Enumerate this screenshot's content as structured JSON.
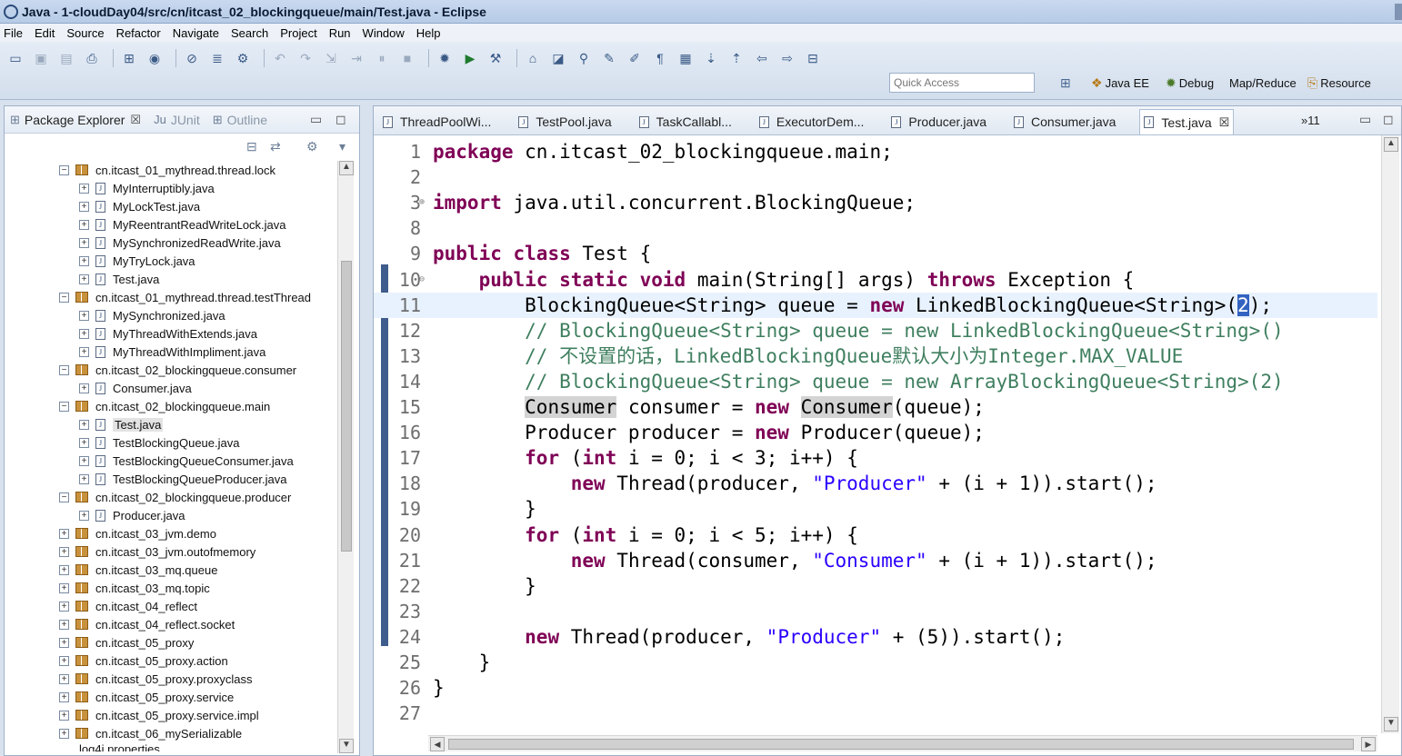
{
  "window": {
    "title": "Java - 1-cloudDay04/src/cn/itcast_02_blockingqueue/main/Test.java - Eclipse"
  },
  "menu": [
    "File",
    "Edit",
    "Source",
    "Refactor",
    "Navigate",
    "Search",
    "Project",
    "Run",
    "Window",
    "Help"
  ],
  "toolbar": {
    "quick_access_placeholder": "Quick Access",
    "perspectives": [
      "Java EE",
      "Debug",
      "Map/Reduce",
      "Resource"
    ]
  },
  "explorer": {
    "tabs": [
      {
        "label": "Package Explorer",
        "active": true
      },
      {
        "label": "JUnit",
        "active": false
      },
      {
        "label": "Outline",
        "active": false
      }
    ],
    "tree": [
      {
        "level": 0,
        "kind": "package",
        "expander": "−",
        "label": "cn.itcast_01_mythread.thread.lock"
      },
      {
        "level": 1,
        "kind": "file",
        "expander": "+",
        "label": "MyInterruptibly.java"
      },
      {
        "level": 1,
        "kind": "file",
        "expander": "+",
        "label": "MyLockTest.java"
      },
      {
        "level": 1,
        "kind": "file",
        "expander": "+",
        "label": "MyReentrantReadWriteLock.java"
      },
      {
        "level": 1,
        "kind": "file",
        "expander": "+",
        "label": "MySynchronizedReadWrite.java"
      },
      {
        "level": 1,
        "kind": "file",
        "expander": "+",
        "label": "MyTryLock.java"
      },
      {
        "level": 1,
        "kind": "file",
        "expander": "+",
        "label": "Test.java"
      },
      {
        "level": 0,
        "kind": "package",
        "expander": "−",
        "label": "cn.itcast_01_mythread.thread.testThread"
      },
      {
        "level": 1,
        "kind": "file",
        "expander": "+",
        "label": "MySynchronized.java"
      },
      {
        "level": 1,
        "kind": "file",
        "expander": "+",
        "label": "MyThreadWithExtends.java"
      },
      {
        "level": 1,
        "kind": "file",
        "expander": "+",
        "label": "MyThreadWithImpliment.java"
      },
      {
        "level": 0,
        "kind": "package",
        "expander": "−",
        "label": "cn.itcast_02_blockingqueue.consumer"
      },
      {
        "level": 1,
        "kind": "file",
        "expander": "+",
        "label": "Consumer.java"
      },
      {
        "level": 0,
        "kind": "package",
        "expander": "−",
        "label": "cn.itcast_02_blockingqueue.main"
      },
      {
        "level": 1,
        "kind": "file",
        "expander": "+",
        "label": "Test.java",
        "selected": true
      },
      {
        "level": 1,
        "kind": "file",
        "expander": "+",
        "label": "TestBlockingQueue.java"
      },
      {
        "level": 1,
        "kind": "file",
        "expander": "+",
        "label": "TestBlockingQueueConsumer.java"
      },
      {
        "level": 1,
        "kind": "file",
        "expander": "+",
        "label": "TestBlockingQueueProducer.java"
      },
      {
        "level": 0,
        "kind": "package",
        "expander": "−",
        "label": "cn.itcast_02_blockingqueue.producer"
      },
      {
        "level": 1,
        "kind": "file",
        "expander": "+",
        "label": "Producer.java"
      },
      {
        "level": 0,
        "kind": "package",
        "expander": "+",
        "label": "cn.itcast_03_jvm.demo"
      },
      {
        "level": 0,
        "kind": "package",
        "expander": "+",
        "label": "cn.itcast_03_jvm.outofmemory"
      },
      {
        "level": 0,
        "kind": "package",
        "expander": "+",
        "label": "cn.itcast_03_mq.queue"
      },
      {
        "level": 0,
        "kind": "package",
        "expander": "+",
        "label": "cn.itcast_03_mq.topic"
      },
      {
        "level": 0,
        "kind": "package",
        "expander": "+",
        "label": "cn.itcast_04_reflect"
      },
      {
        "level": 0,
        "kind": "package",
        "expander": "+",
        "label": "cn.itcast_04_reflect.socket"
      },
      {
        "level": 0,
        "kind": "package",
        "expander": "+",
        "label": "cn.itcast_05_proxy"
      },
      {
        "level": 0,
        "kind": "package",
        "expander": "+",
        "label": "cn.itcast_05_proxy.action"
      },
      {
        "level": 0,
        "kind": "package",
        "expander": "+",
        "label": "cn.itcast_05_proxy.proxyclass"
      },
      {
        "level": 0,
        "kind": "package",
        "expander": "+",
        "label": "cn.itcast_05_proxy.service"
      },
      {
        "level": 0,
        "kind": "package",
        "expander": "+",
        "label": "cn.itcast_05_proxy.service.impl"
      },
      {
        "level": 0,
        "kind": "package",
        "expander": "+",
        "label": "cn.itcast_06_mySerializable"
      }
    ],
    "partial_row": "log4j.properties"
  },
  "editor": {
    "tabs": [
      {
        "label": "ThreadPoolWi...",
        "active": false
      },
      {
        "label": "TestPool.java",
        "active": false
      },
      {
        "label": "TaskCallabl...",
        "active": false
      },
      {
        "label": "ExecutorDem...",
        "active": false
      },
      {
        "label": "Producer.java",
        "active": false
      },
      {
        "label": "Consumer.java",
        "active": false
      },
      {
        "label": "Test.java",
        "active": true
      }
    ],
    "overflow_count": "»11",
    "lines": [
      {
        "num": "1",
        "fold": "",
        "current": false,
        "tokens": [
          [
            "kw",
            "package"
          ],
          [
            "t",
            " cn.itcast_02_blockingqueue.main;"
          ]
        ]
      },
      {
        "num": "2",
        "fold": "",
        "current": false,
        "tokens": []
      },
      {
        "num": "3",
        "fold": "⊕",
        "current": false,
        "tokens": [
          [
            "kw",
            "import"
          ],
          [
            "t",
            " java.util.concurrent.BlockingQueue;"
          ]
        ]
      },
      {
        "num": "8",
        "fold": "",
        "current": false,
        "tokens": []
      },
      {
        "num": "9",
        "fold": "",
        "current": false,
        "tokens": [
          [
            "kw",
            "public"
          ],
          [
            "t",
            " "
          ],
          [
            "kw",
            "class"
          ],
          [
            "t",
            " Test {"
          ]
        ]
      },
      {
        "num": "10",
        "fold": "⊖",
        "current": false,
        "tokens": [
          [
            "t",
            "    "
          ],
          [
            "kw",
            "public"
          ],
          [
            "t",
            " "
          ],
          [
            "kw",
            "static"
          ],
          [
            "t",
            " "
          ],
          [
            "kw",
            "void"
          ],
          [
            "t",
            " main(String[] args) "
          ],
          [
            "kw",
            "throws"
          ],
          [
            "t",
            " Exception {"
          ]
        ]
      },
      {
        "num": "11",
        "fold": "",
        "current": true,
        "tokens": [
          [
            "t",
            "        BlockingQueue<String> queue = "
          ],
          [
            "kw",
            "new"
          ],
          [
            "t",
            " LinkedBlockingQueue<String>("
          ],
          [
            "sel",
            "2"
          ],
          [
            "t",
            ");"
          ]
        ]
      },
      {
        "num": "12",
        "fold": "",
        "current": false,
        "tokens": [
          [
            "t",
            "        "
          ],
          [
            "cm",
            "// BlockingQueue<String> queue = new LinkedBlockingQueue<String>()"
          ]
        ]
      },
      {
        "num": "13",
        "fold": "",
        "current": false,
        "tokens": [
          [
            "t",
            "        "
          ],
          [
            "cm",
            "// 不设置的话，LinkedBlockingQueue默认大小为Integer.MAX_VALUE"
          ]
        ]
      },
      {
        "num": "14",
        "fold": "",
        "current": false,
        "tokens": [
          [
            "t",
            "        "
          ],
          [
            "cm",
            "// BlockingQueue<String> queue = new ArrayBlockingQueue<String>(2)"
          ]
        ]
      },
      {
        "num": "15",
        "fold": "",
        "current": false,
        "tokens": [
          [
            "t",
            "        "
          ],
          [
            "hl",
            "Consumer"
          ],
          [
            "t",
            " consumer = "
          ],
          [
            "kw",
            "new"
          ],
          [
            "t",
            " "
          ],
          [
            "hl",
            "Consumer"
          ],
          [
            "t",
            "(queue);"
          ]
        ]
      },
      {
        "num": "16",
        "fold": "",
        "current": false,
        "tokens": [
          [
            "t",
            "        Producer producer = "
          ],
          [
            "kw",
            "new"
          ],
          [
            "t",
            " Producer(queue);"
          ]
        ]
      },
      {
        "num": "17",
        "fold": "",
        "current": false,
        "tokens": [
          [
            "t",
            "        "
          ],
          [
            "kw",
            "for"
          ],
          [
            "t",
            " ("
          ],
          [
            "kw",
            "int"
          ],
          [
            "t",
            " i = 0; i < 3; i++) {"
          ]
        ]
      },
      {
        "num": "18",
        "fold": "",
        "current": false,
        "tokens": [
          [
            "t",
            "            "
          ],
          [
            "kw",
            "new"
          ],
          [
            "t",
            " Thread(producer, "
          ],
          [
            "str",
            "\"Producer\""
          ],
          [
            "t",
            " + (i + 1)).start();"
          ]
        ]
      },
      {
        "num": "19",
        "fold": "",
        "current": false,
        "tokens": [
          [
            "t",
            "        }"
          ]
        ]
      },
      {
        "num": "20",
        "fold": "",
        "current": false,
        "tokens": [
          [
            "t",
            "        "
          ],
          [
            "kw",
            "for"
          ],
          [
            "t",
            " ("
          ],
          [
            "kw",
            "int"
          ],
          [
            "t",
            " i = 0; i < 5; i++) {"
          ]
        ]
      },
      {
        "num": "21",
        "fold": "",
        "current": false,
        "tokens": [
          [
            "t",
            "            "
          ],
          [
            "kw",
            "new"
          ],
          [
            "t",
            " Thread(consumer, "
          ],
          [
            "str",
            "\"Consumer\""
          ],
          [
            "t",
            " + (i + 1)).start();"
          ]
        ]
      },
      {
        "num": "22",
        "fold": "",
        "current": false,
        "tokens": [
          [
            "t",
            "        }"
          ]
        ]
      },
      {
        "num": "23",
        "fold": "",
        "current": false,
        "tokens": []
      },
      {
        "num": "24",
        "fold": "",
        "current": false,
        "tokens": [
          [
            "t",
            "        "
          ],
          [
            "kw",
            "new"
          ],
          [
            "t",
            " Thread(producer, "
          ],
          [
            "str",
            "\"Producer\""
          ],
          [
            "t",
            " + (5)).start();"
          ]
        ]
      },
      {
        "num": "25",
        "fold": "",
        "current": false,
        "tokens": [
          [
            "t",
            "    }"
          ]
        ]
      },
      {
        "num": "26",
        "fold": "",
        "current": false,
        "tokens": [
          [
            "t",
            "}"
          ]
        ]
      },
      {
        "num": "27",
        "fold": "",
        "current": false,
        "tokens": []
      }
    ]
  },
  "colors": {
    "keyword": "#7f0055",
    "string": "#2a00ff",
    "comment": "#3f7f5f",
    "current_line": "#e8f2fe"
  }
}
